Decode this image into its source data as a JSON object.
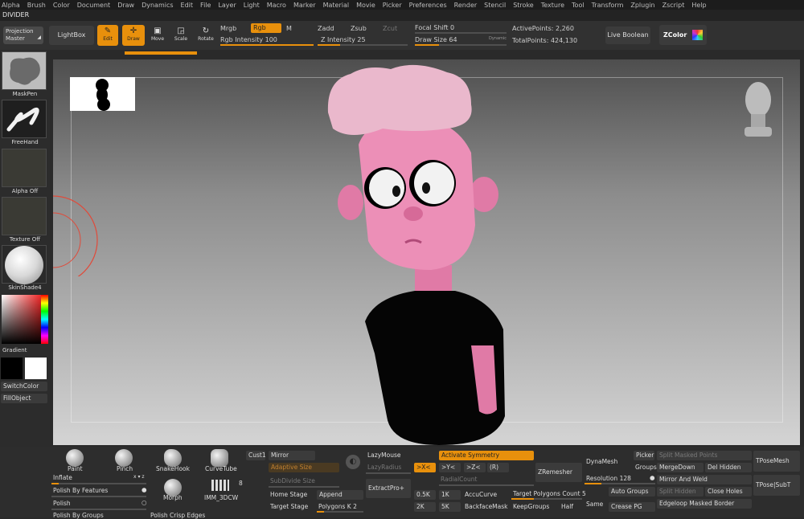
{
  "menu": [
    "Alpha",
    "Brush",
    "Color",
    "Document",
    "Draw",
    "Dynamics",
    "Edit",
    "File",
    "Layer",
    "Light",
    "Macro",
    "Marker",
    "Material",
    "Movie",
    "Picker",
    "Preferences",
    "Render",
    "Stencil",
    "Stroke",
    "Texture",
    "Tool",
    "Transform",
    "Zplugin",
    "Zscript",
    "Help"
  ],
  "subtitle": "DIVIDER",
  "toolbar": {
    "projection_master": "Projection Master",
    "lightbox": "LightBox",
    "edit": "Edit",
    "draw": "Draw",
    "move": "Move",
    "scale": "Scale",
    "rotate": "Rotate",
    "mrgb": "Mrgb",
    "rgb": "Rgb",
    "m": "M",
    "rgb_intensity": "Rgb Intensity 100",
    "zadd": "Zadd",
    "zsub": "Zsub",
    "zcut": "Zcut",
    "z_intensity": "Z Intensity 25",
    "focal_shift": "Focal Shift 0",
    "draw_size": "Draw Size 64",
    "dynamic": "Dynamic",
    "active_points": "ActivePoints: 2,260",
    "total_points": "TotalPoints: 424,130",
    "live_boolean": "Live Boolean",
    "zcolor": "ZColor"
  },
  "left": {
    "maskpen": "MaskPen",
    "freehand": "FreeHand",
    "alpha_off": "Alpha Off",
    "texture_off": "Texture Off",
    "material": "SkinShade4",
    "gradient": "Gradient",
    "switch_color": "SwitchColor",
    "fill_object": "FillObject"
  },
  "bottom": {
    "paint": "Paint",
    "pinch": "Pinch",
    "snakehook": "SnakeHook",
    "curvetube": "CurveTube",
    "inflate": "Inflate",
    "morph": "Morph",
    "imm": "IMM_3DCW",
    "imm_count": "8",
    "polish_features": "Polish By Features",
    "polish": "Polish",
    "polish_groups": "Polish By Groups",
    "polish_crisp": "Polish Crisp Edges",
    "cust1": "Cust1",
    "mirror": "Mirror",
    "adaptive_size": "Adaptive Size",
    "subdivide_size": "SubDivide Size",
    "home_stage": "Home Stage",
    "append": "Append",
    "target_stage": "Target Stage",
    "polygons_k": "Polygons K 2",
    "lazymouse": "LazyMouse",
    "lazyradius": "LazyRadius",
    "extractpro": "ExtractPro+",
    "activate_symmetry": "Activate Symmetry",
    "x": ">X<",
    "y": ">Y<",
    "z": ">Z<",
    "r": "(R)",
    "radialcount": "RadialCount",
    "zremesher": "ZRemesher",
    "k05": "0.5K",
    "k1": "1K",
    "k2": "2K",
    "k5": "5K",
    "accucurve": "AccuCurve",
    "backfacemask": "BackfaceMask",
    "target_polygons": "Target Polygons Count 5",
    "keepgroups": "KeepGroups",
    "half": "Half",
    "same": "Same",
    "dynamesh": "DynaMesh",
    "resolution": "Resolution 128",
    "picker": "Picker",
    "groups": "Groups",
    "auto_groups": "Auto Groups",
    "crease_pg": "Crease PG",
    "split_masked": "Split Masked Points",
    "mergedown": "MergeDown",
    "del_hidden": "Del Hidden",
    "mirror_weld": "Mirror And Weld",
    "split_hidden": "Split Hidden",
    "close_holes": "Close Holes",
    "edgeloop": "Edgeloop Masked Border",
    "tposemesh": "TPoseMesh",
    "tpose_subt": "TPose|SubT"
  }
}
